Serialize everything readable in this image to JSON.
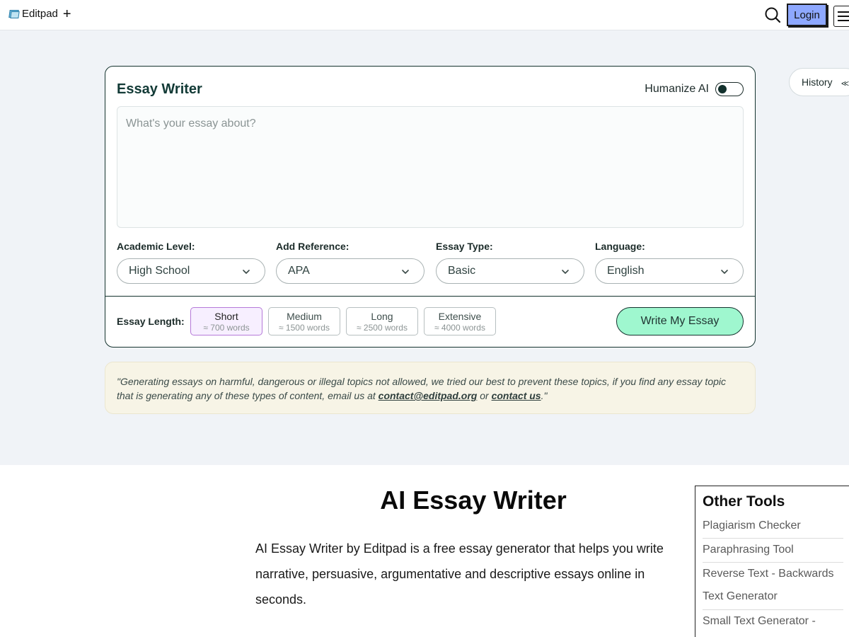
{
  "header": {
    "brand": "Editpad",
    "plus": "+",
    "login_label": "Login"
  },
  "icons": {
    "logo": "editpad-logo-icon",
    "search": "search-icon",
    "menu": "hamburger-menu-icon",
    "toggle": "toggle-switch-icon",
    "chevron": "chevron-down-icon",
    "history": "double-chevron-left-icon"
  },
  "colors": {
    "accent_green": "#9ff7cf",
    "login_blue": "#8ea8ff",
    "active_purple": "#b579d8",
    "brand_dark": "#123a36"
  },
  "tool": {
    "title": "Essay Writer",
    "humanize_label": "Humanize AI",
    "humanize_on": false,
    "prompt_placeholder": "What's your essay about?",
    "prompt_value": "",
    "fields": [
      {
        "label": "Academic Level:",
        "value": "High School"
      },
      {
        "label": "Add Reference:",
        "value": "APA"
      },
      {
        "label": "Essay Type:",
        "value": "Basic"
      },
      {
        "label": "Language:",
        "value": "English"
      }
    ],
    "length_label": "Essay Length:",
    "lengths": [
      {
        "title": "Short",
        "sub": "≈ 700 words",
        "active": true
      },
      {
        "title": "Medium",
        "sub": "≈ 1500 words",
        "active": false
      },
      {
        "title": "Long",
        "sub": "≈ 2500 words",
        "active": false
      },
      {
        "title": "Extensive",
        "sub": "≈ 4000 words",
        "active": false
      }
    ],
    "submit_label": "Write My Essay"
  },
  "history": {
    "label": "History",
    "icon_glyph": "<<"
  },
  "notice": {
    "part1": "\"Generating essays on harmful, dangerous or illegal topics not allowed, we tried our best to prevent these topics, if you find any essay topic that is generating any of these types of content, email us at ",
    "email": "contact@editpad.org",
    "part2": " or ",
    "contact": "contact us",
    "part3": ".\""
  },
  "content": {
    "title": "AI Essay Writer",
    "description": "AI Essay Writer by Editpad is a free essay generator that helps you write narrative, persuasive, argumentative and descriptive essays online in seconds."
  },
  "sidebar": {
    "title": "Other Tools",
    "items": [
      "Plagiarism Checker",
      "Paraphrasing Tool",
      "Reverse Text - Backwards Text Generator",
      "Small Text Generator -"
    ]
  }
}
